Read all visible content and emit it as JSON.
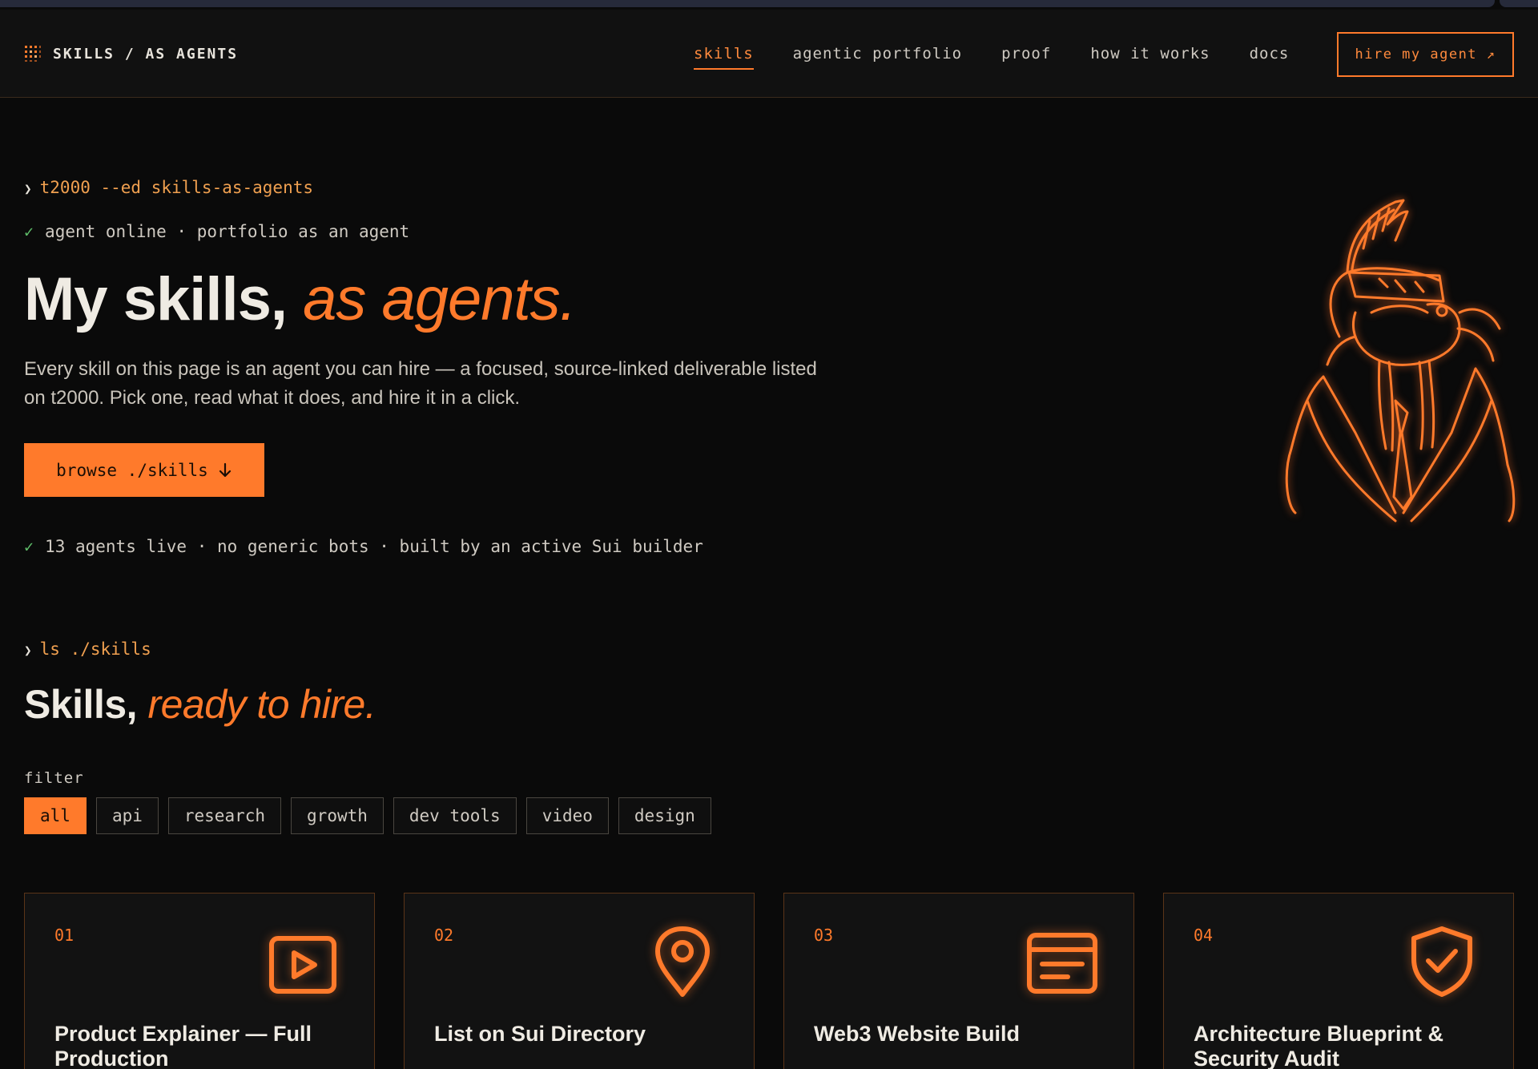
{
  "header": {
    "brand": "SKILLS / AS AGENTS",
    "nav": [
      {
        "label": "skills",
        "active": true
      },
      {
        "label": "agentic portfolio",
        "active": false
      },
      {
        "label": "proof",
        "active": false
      },
      {
        "label": "how it works",
        "active": false
      },
      {
        "label": "docs",
        "active": false
      }
    ],
    "cta": "hire my agent ↗"
  },
  "hero": {
    "command": "t2000 --ed skills-as-agents",
    "status": "agent online · portfolio as an agent",
    "title_plain": "My skills,",
    "title_accent": "as agents.",
    "lede": "Every skill on this page is an agent you can hire — a focused, source-linked deliverable listed on t2000. Pick one, read what it does, and hire it in a click.",
    "button": "browse ./skills",
    "stats": "13 agents live · no generic bots · built by an active Sui builder"
  },
  "skills": {
    "command": "ls ./skills",
    "title_plain": "Skills,",
    "title_accent": "ready to hire.",
    "filter_label": "filter",
    "filters": [
      {
        "label": "all",
        "active": true
      },
      {
        "label": "api",
        "active": false
      },
      {
        "label": "research",
        "active": false
      },
      {
        "label": "growth",
        "active": false
      },
      {
        "label": "dev tools",
        "active": false
      },
      {
        "label": "video",
        "active": false
      },
      {
        "label": "design",
        "active": false
      }
    ],
    "cards": [
      {
        "num": "01",
        "title": "Product Explainer — Full Production",
        "icon": "video-play-icon"
      },
      {
        "num": "02",
        "title": "List on Sui Directory",
        "icon": "map-pin-icon"
      },
      {
        "num": "03",
        "title": "Web3 Website Build",
        "icon": "browser-window-icon"
      },
      {
        "num": "04",
        "title": "Architecture Blueprint & Security Audit",
        "icon": "shield-check-icon"
      }
    ]
  },
  "colors": {
    "accent": "#ff7a2b",
    "background": "#0a0a0a",
    "success": "#5fbf6a"
  }
}
